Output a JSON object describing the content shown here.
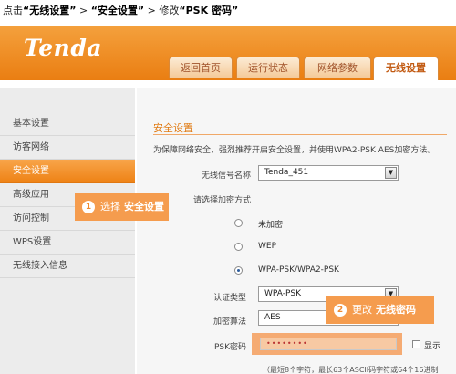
{
  "instruction": {
    "prefix": "点击",
    "step1": "“无线设置”",
    "sep1": " > ",
    "step2": "“安全设置”",
    "sep2": " > 修改",
    "step3": "“PSK 密码”"
  },
  "brand": {
    "logo_text": "Tenda"
  },
  "tabs": [
    {
      "label": "返回首页"
    },
    {
      "label": "运行状态"
    },
    {
      "label": "网络参数"
    },
    {
      "label": "无线设置",
      "active": true
    }
  ],
  "sidebar": {
    "items": [
      {
        "label": "基本设置"
      },
      {
        "label": "访客网络"
      },
      {
        "label": "安全设置",
        "active": true
      },
      {
        "label": "高级应用"
      },
      {
        "label": "访问控制"
      },
      {
        "label": "WPS设置"
      },
      {
        "label": "无线接入信息"
      }
    ]
  },
  "main": {
    "section_title": "安全设置",
    "description": "为保障网络安全，强烈推荐开启安全设置，并使用WPA2-PSK AES加密方法。",
    "ssid_label": "无线信号名称",
    "ssid_value": "Tenda_451",
    "encryption_label": "请选择加密方式",
    "options": [
      {
        "label": "未加密",
        "checked": false
      },
      {
        "label": "WEP",
        "checked": false
      },
      {
        "label": "WPA-PSK/WPA2-PSK",
        "checked": true
      }
    ],
    "auth_label": "认证类型",
    "auth_value": "WPA-PSK",
    "algo_label": "加密算法",
    "algo_value": "AES",
    "psk_label": "PSK密码",
    "psk_value": "••••••••",
    "show_label": "显示",
    "hint": "（最短8个字符，最长63个ASCII码字符或64个16进制"
  },
  "callouts": [
    {
      "num": "1",
      "text": "选择",
      "bold": "安全设置"
    },
    {
      "num": "2",
      "text": "更改",
      "bold": "无线密码"
    }
  ],
  "colors": {
    "accent": "#ee8215",
    "header_orange": "#ea7e12",
    "callout": "#f59c4e"
  }
}
